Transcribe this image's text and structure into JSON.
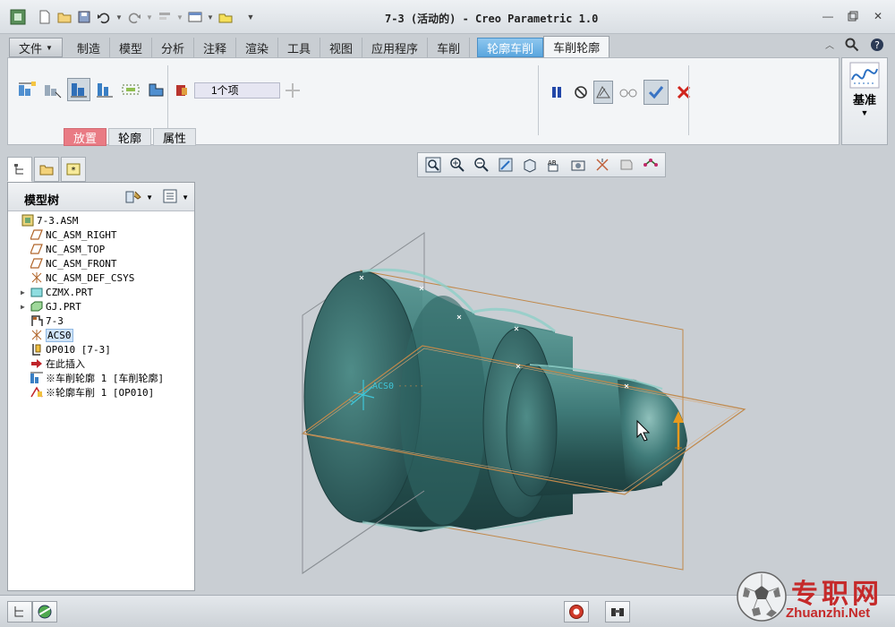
{
  "window": {
    "title": "7-3 (活动的) - Creo Parametric 1.0"
  },
  "quick_access": [
    "new-icon",
    "open-icon",
    "save-icon",
    "undo-icon",
    "redo-icon",
    "regenerate-icon",
    "windows-icon",
    "close-window-icon",
    "customize-icon"
  ],
  "ribbon": {
    "tabs": [
      {
        "label": "文件",
        "kind": "file"
      },
      {
        "label": "制造"
      },
      {
        "label": "模型"
      },
      {
        "label": "分析"
      },
      {
        "label": "注释"
      },
      {
        "label": "渲染"
      },
      {
        "label": "工具"
      },
      {
        "label": "视图"
      },
      {
        "label": "应用程序"
      },
      {
        "label": "车削"
      },
      {
        "label": "轮廓车削",
        "kind": "highlight"
      },
      {
        "label": "车削轮廓",
        "kind": "active"
      }
    ]
  },
  "dashboard": {
    "reference_collector": "1个项",
    "subtabs": [
      {
        "label": "放置",
        "active": true
      },
      {
        "label": "轮廓"
      },
      {
        "label": "属性"
      }
    ],
    "datum_label": "基准"
  },
  "model_tree": {
    "title": "模型树",
    "nodes": [
      {
        "text": "7-3.ASM",
        "icon": "assembly-icon",
        "level": 0
      },
      {
        "text": "NC_ASM_RIGHT",
        "icon": "datum-plane-icon",
        "level": 1
      },
      {
        "text": "NC_ASM_TOP",
        "icon": "datum-plane-icon",
        "level": 1
      },
      {
        "text": "NC_ASM_FRONT",
        "icon": "datum-plane-icon",
        "level": 1
      },
      {
        "text": "NC_ASM_DEF_CSYS",
        "icon": "csys-icon",
        "level": 1
      },
      {
        "text": "CZMX.PRT",
        "icon": "part-icon",
        "level": 1,
        "expandable": true
      },
      {
        "text": "GJ.PRT",
        "icon": "workpiece-icon",
        "level": 1,
        "expandable": true
      },
      {
        "text": "7-3",
        "icon": "workcell-icon",
        "level": 1
      },
      {
        "text": "ACS0",
        "icon": "csys-icon",
        "level": 1,
        "selected": true
      },
      {
        "text": "OP010 [7-3]",
        "icon": "operation-icon",
        "level": 1
      },
      {
        "text": "在此插入",
        "icon": "insert-here-icon",
        "level": 1
      },
      {
        "text": "※车削轮廓 1 [车削轮廓]",
        "icon": "turn-profile-icon",
        "level": 1
      },
      {
        "text": "※轮廓车削 1 [OP010]",
        "icon": "profile-turning-icon",
        "level": 1
      }
    ]
  },
  "graphics": {
    "csys_label": "ACS0",
    "shaft_color": "#3f7a78",
    "plane_color": "#c0884a"
  },
  "watermark": {
    "cn": "专职网",
    "en": "Zhuanzhi.Net"
  }
}
